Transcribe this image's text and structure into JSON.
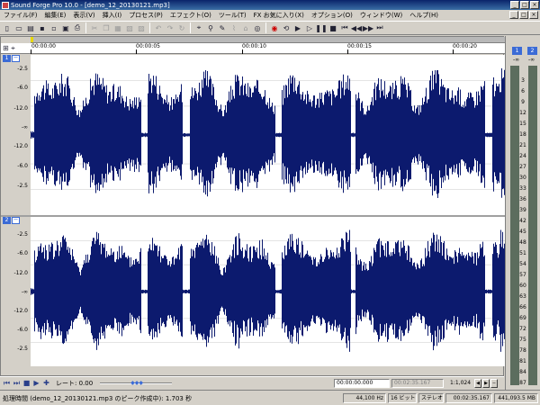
{
  "window": {
    "title": "Sound Forge Pro 10.0 - [demo_12_20130121.mp3]",
    "controls": [
      "_",
      "□",
      "×"
    ]
  },
  "menu": {
    "items": [
      "ファイル(F)",
      "編集(E)",
      "表示(V)",
      "挿入(I)",
      "プロセス(P)",
      "エフェクト(O)",
      "ツール(T)",
      "FX お気に入り(X)",
      "オプション(O)",
      "ウィンドウ(W)",
      "ヘルプ(H)"
    ],
    "mdi_controls": [
      "_",
      "□",
      "×"
    ]
  },
  "toolbar": {
    "icons": [
      "new-icon",
      "open-icon",
      "open-folder-icon",
      "save-icon",
      "save-all-icon",
      "properties-icon",
      "print-icon",
      "cut-icon",
      "copy-icon",
      "paste-icon",
      "mix-icon",
      "trim-icon",
      "undo-icon",
      "redo-icon",
      "repeat-icon",
      "edit-tool-icon",
      "magnify-icon",
      "pencil-icon",
      "envelope-icon",
      "event-icon",
      "snap-icon",
      "record-icon",
      "loop-icon",
      "play-all-icon",
      "play-icon",
      "pause-icon",
      "stop-icon",
      "go-start-icon",
      "rewind-icon",
      "forward-icon",
      "go-end-icon"
    ]
  },
  "ruler": {
    "labels": [
      "00:00:00",
      "00:00:05",
      "00:00:10",
      "00:00:15",
      "00:00:20"
    ]
  },
  "channels": [
    {
      "number": "1",
      "collapse": "−",
      "axis": [
        "-2.5",
        "-6.0",
        "-12.0",
        "-∞",
        "-12.0",
        "-6.0",
        "-2.5"
      ]
    },
    {
      "number": "2",
      "collapse": "−",
      "axis": [
        "-2.5",
        "-6.0",
        "-12.0",
        "-∞",
        "-12.0",
        "-6.0",
        "-2.5"
      ]
    }
  ],
  "colors": {
    "waveform": "#0c1a6e",
    "wave_background": "#ffffff",
    "channel_badge": "#3b6bd6",
    "titlebar": "#0a246a",
    "meter_background": "#5c6d5e"
  },
  "transport": {
    "rate_label": "レート: 0.00",
    "selection_start": "00:00:00.000",
    "selection_end": "00:02:35.167",
    "zoom": "1:1,024"
  },
  "status": {
    "message": "処理時間 (demo_12_20130121.mp3 のピーク作成中): 1.703 秒",
    "sample_rate": "44,100 Hz",
    "bit_depth": "16 ビット",
    "channels": "ステレオ",
    "length": "00:02:35.167",
    "size": "441,093.5 MB"
  },
  "meters": {
    "channels": [
      "1",
      "2"
    ],
    "peaks": [
      "-∞",
      "-∞"
    ],
    "scale": [
      "3",
      "6",
      "9",
      "12",
      "15",
      "18",
      "21",
      "24",
      "27",
      "30",
      "33",
      "36",
      "39",
      "42",
      "45",
      "48",
      "51",
      "54",
      "57",
      "60",
      "63",
      "66",
      "69",
      "72",
      "75",
      "78",
      "81",
      "84",
      "87"
    ]
  }
}
